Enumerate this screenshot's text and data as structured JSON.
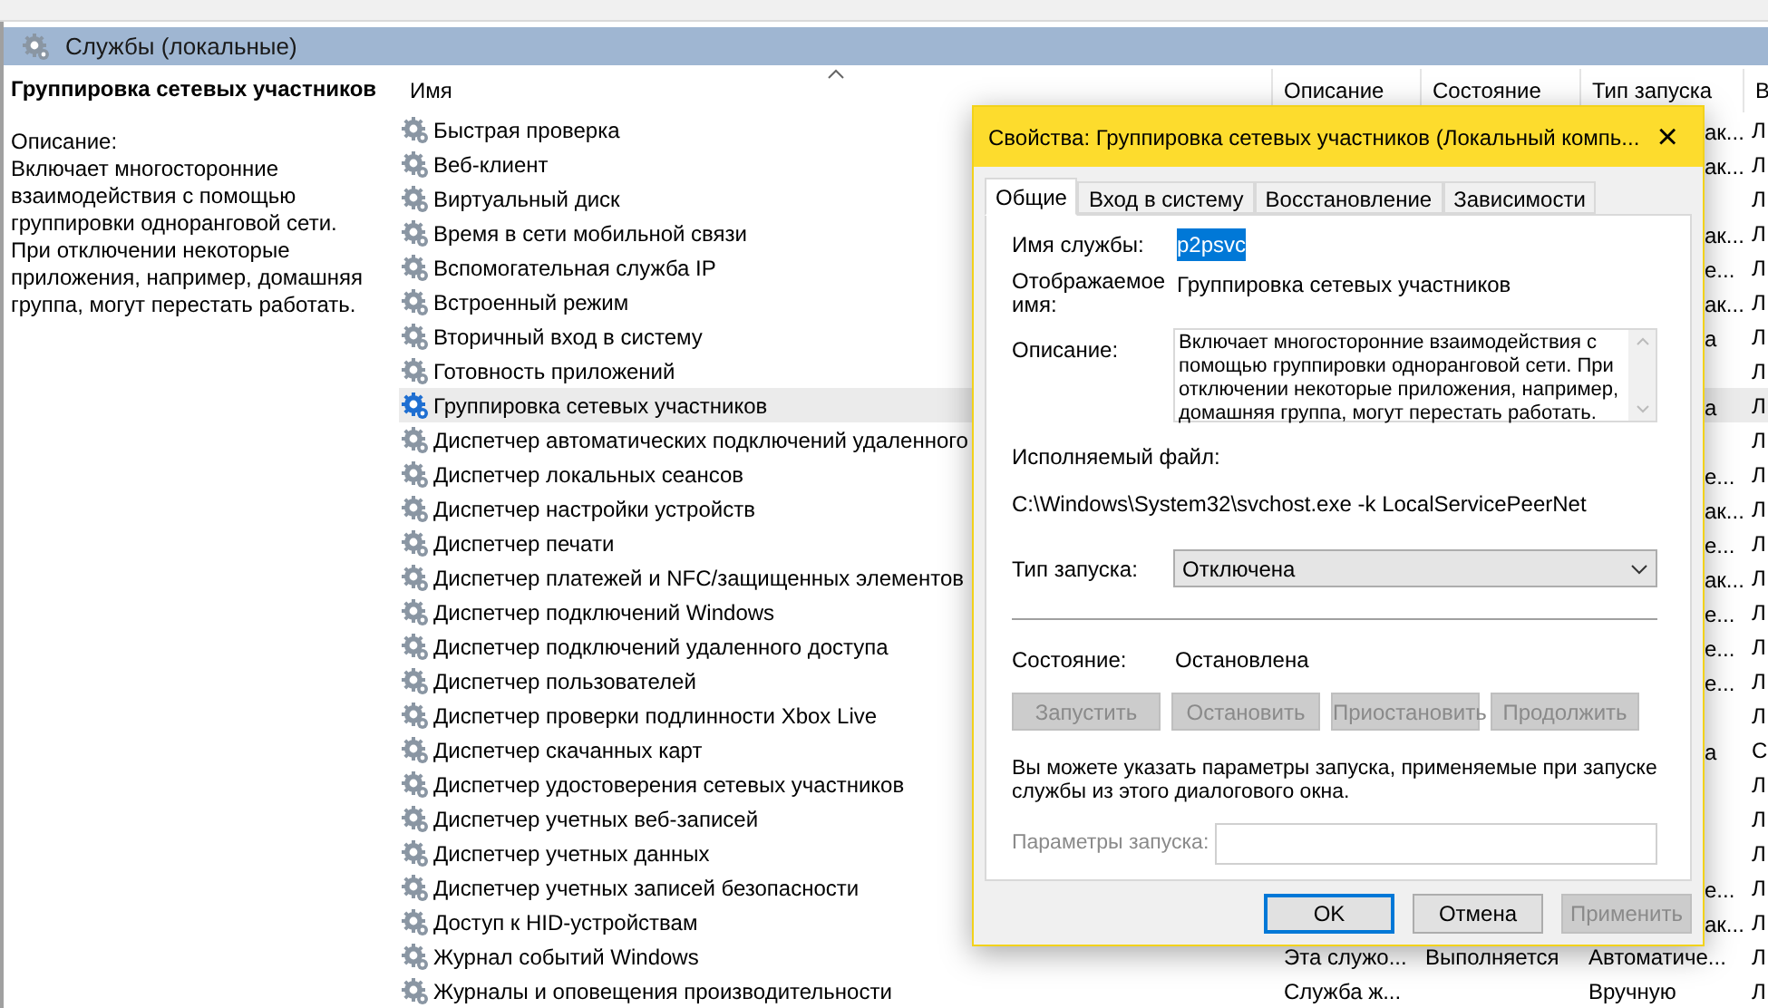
{
  "header": {
    "title": "Службы (локальные)"
  },
  "details": {
    "name": "Группировка сетевых участников",
    "description_label": "Описание:",
    "description": "Включает многосторонние взаимодействия с помощью группировки одноранговой сети. При отключении некоторые приложения, например, домашняя группа, могут перестать работать."
  },
  "table": {
    "columns": [
      {
        "label": "Имя",
        "sorted": true
      },
      {
        "label": "Описание",
        "sorted": false
      },
      {
        "label": "Состояние",
        "sorted": false
      },
      {
        "label": "Тип запуска",
        "sorted": false
      },
      {
        "label": "В",
        "sorted": false
      }
    ],
    "rows": [
      {
        "name": "Быстрая проверка",
        "startup_fragment": "ак...",
        "column_5": "Л",
        "selected": false
      },
      {
        "name": "Веб-клиент",
        "startup_fragment": "ак...",
        "column_5": "Л",
        "selected": false
      },
      {
        "name": "Виртуальный диск",
        "column_5": "Л",
        "selected": false
      },
      {
        "name": "Время в сети мобильной связи",
        "startup_fragment": "ак...",
        "column_5": "Л",
        "selected": false
      },
      {
        "name": "Вспомогательная служба IP",
        "startup_fragment": "е...",
        "column_5": "Л",
        "selected": false
      },
      {
        "name": "Встроенный режим",
        "startup_fragment": "ак...",
        "column_5": "Л",
        "selected": false
      },
      {
        "name": "Вторичный вход в систему",
        "startup_fragment": "а",
        "column_5": "Л",
        "selected": false
      },
      {
        "name": "Готовность приложений",
        "column_5": "Л",
        "selected": false
      },
      {
        "name": "Группировка сетевых участников",
        "startup_fragment": "а",
        "column_5": "Л",
        "selected": true
      },
      {
        "name": "Диспетчер автоматических подключений удаленного",
        "column_5": "Л",
        "selected": false
      },
      {
        "name": "Диспетчер локальных сеансов",
        "startup_fragment": "е...",
        "column_5": "Л",
        "selected": false
      },
      {
        "name": "Диспетчер настройки устройств",
        "startup_fragment": "ак...",
        "column_5": "Л",
        "selected": false
      },
      {
        "name": "Диспетчер печати",
        "startup_fragment": "е...",
        "column_5": "Л",
        "selected": false
      },
      {
        "name": "Диспетчер платежей и NFC/защищенных элементов",
        "startup_fragment": "ак...",
        "column_5": "Л",
        "selected": false
      },
      {
        "name": "Диспетчер подключений Windows",
        "startup_fragment": "е...",
        "column_5": "Л",
        "selected": false
      },
      {
        "name": "Диспетчер подключений удаленного доступа",
        "startup_fragment": "е...",
        "column_5": "Л",
        "selected": false
      },
      {
        "name": "Диспетчер пользователей",
        "startup_fragment": "е...",
        "column_5": "Л",
        "selected": false
      },
      {
        "name": "Диспетчер проверки подлинности Xbox Live",
        "column_5": "Л",
        "selected": false
      },
      {
        "name": "Диспетчер скачанных карт",
        "startup_fragment": "а",
        "column_5": "С",
        "selected": false
      },
      {
        "name": "Диспетчер удостоверения сетевых участников",
        "column_5": "Л",
        "selected": false
      },
      {
        "name": "Диспетчер учетных веб-записей",
        "column_5": "Л",
        "selected": false
      },
      {
        "name": "Диспетчер учетных данных",
        "column_5": "Л",
        "selected": false
      },
      {
        "name": "Диспетчер учетных записей безопасности",
        "startup_fragment": "е...",
        "column_5": "Л",
        "selected": false
      },
      {
        "name": "Доступ к HID-устройствам",
        "startup_fragment": "ак...",
        "column_5": "Л",
        "selected": false
      },
      {
        "name": "Журнал событий Windows",
        "description": "Эта служо...",
        "state": "Выполняется",
        "startup": "Автоматиче...",
        "column_5": "Л",
        "selected": false
      },
      {
        "name": "Журналы и оповещения производительности",
        "description": "Служба ж...",
        "startup": "Вручную",
        "column_5": "Л",
        "selected": false
      }
    ]
  },
  "dialog": {
    "title": "Свойства: Группировка сетевых участников (Локальный компь...",
    "close": "×",
    "tabs": [
      {
        "label": "Общие",
        "selected": true
      },
      {
        "label": "Вход в систему",
        "selected": false
      },
      {
        "label": "Восстановление",
        "selected": false
      },
      {
        "label": "Зависимости",
        "selected": false
      }
    ],
    "service_name_label": "Имя службы:",
    "service_name": "p2psvc",
    "service_name_highlighted": true,
    "display_name_label": "Отображаемое имя:",
    "display_name": "Группировка сетевых участников",
    "description_label": "Описание:",
    "description": "Включает многосторонние взаимодействия с помощью группировки одноранговой сети. При отключении некоторые приложения, например, домашняя группа, могут перестать работать.",
    "executable_label": "Исполняемый файл:",
    "executable": "C:\\Windows\\System32\\svchost.exe -k LocalServicePeerNet",
    "startup_type_label": "Тип запуска:",
    "startup_type": "Отключена",
    "status_label": "Состояние:",
    "status": "Остановлена",
    "service_buttons": [
      {
        "label": "Запустить",
        "disabled": true
      },
      {
        "label": "Остановить",
        "disabled": true
      },
      {
        "label": "Приостановить",
        "disabled": true
      },
      {
        "label": "Продолжить",
        "disabled": true
      }
    ],
    "note": "Вы можете указать параметры запуска, применяемые при запуске службы из этого диалогового окна.",
    "parameters_label": "Параметры запуска:",
    "parameters_disabled": true,
    "buttons": [
      {
        "label": "OK",
        "default": true,
        "disabled": false
      },
      {
        "label": "Отмена",
        "default": false,
        "disabled": false
      },
      {
        "label": "Применить",
        "default": false,
        "disabled": true
      }
    ]
  }
}
